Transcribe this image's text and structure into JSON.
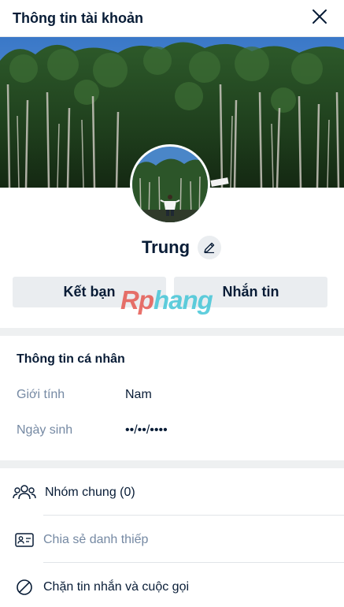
{
  "header": {
    "title": "Thông tin tài khoản"
  },
  "profile": {
    "name": "Trung"
  },
  "buttons": {
    "add_friend": "Kết bạn",
    "message": "Nhắn tin"
  },
  "watermark": {
    "part1": "Rp",
    "part2": "hang"
  },
  "personal_info": {
    "title": "Thông tin cá nhân",
    "rows": [
      {
        "label": "Giới tính",
        "value": "Nam"
      },
      {
        "label": "Ngày sinh",
        "value": "••/••/••••"
      }
    ]
  },
  "actions": [
    {
      "label": "Nhóm chung (0)",
      "icon": "group-icon"
    },
    {
      "label": "Chia sẻ danh thiếp",
      "icon": "contact-card-icon"
    },
    {
      "label": "Chặn tin nhắn và cuộc gọi",
      "icon": "block-icon"
    }
  ],
  "colors": {
    "text_primary": "#081c36",
    "text_secondary": "#7589a3",
    "button_bg": "#eaedf0",
    "divider_bg": "#eef0f1"
  }
}
